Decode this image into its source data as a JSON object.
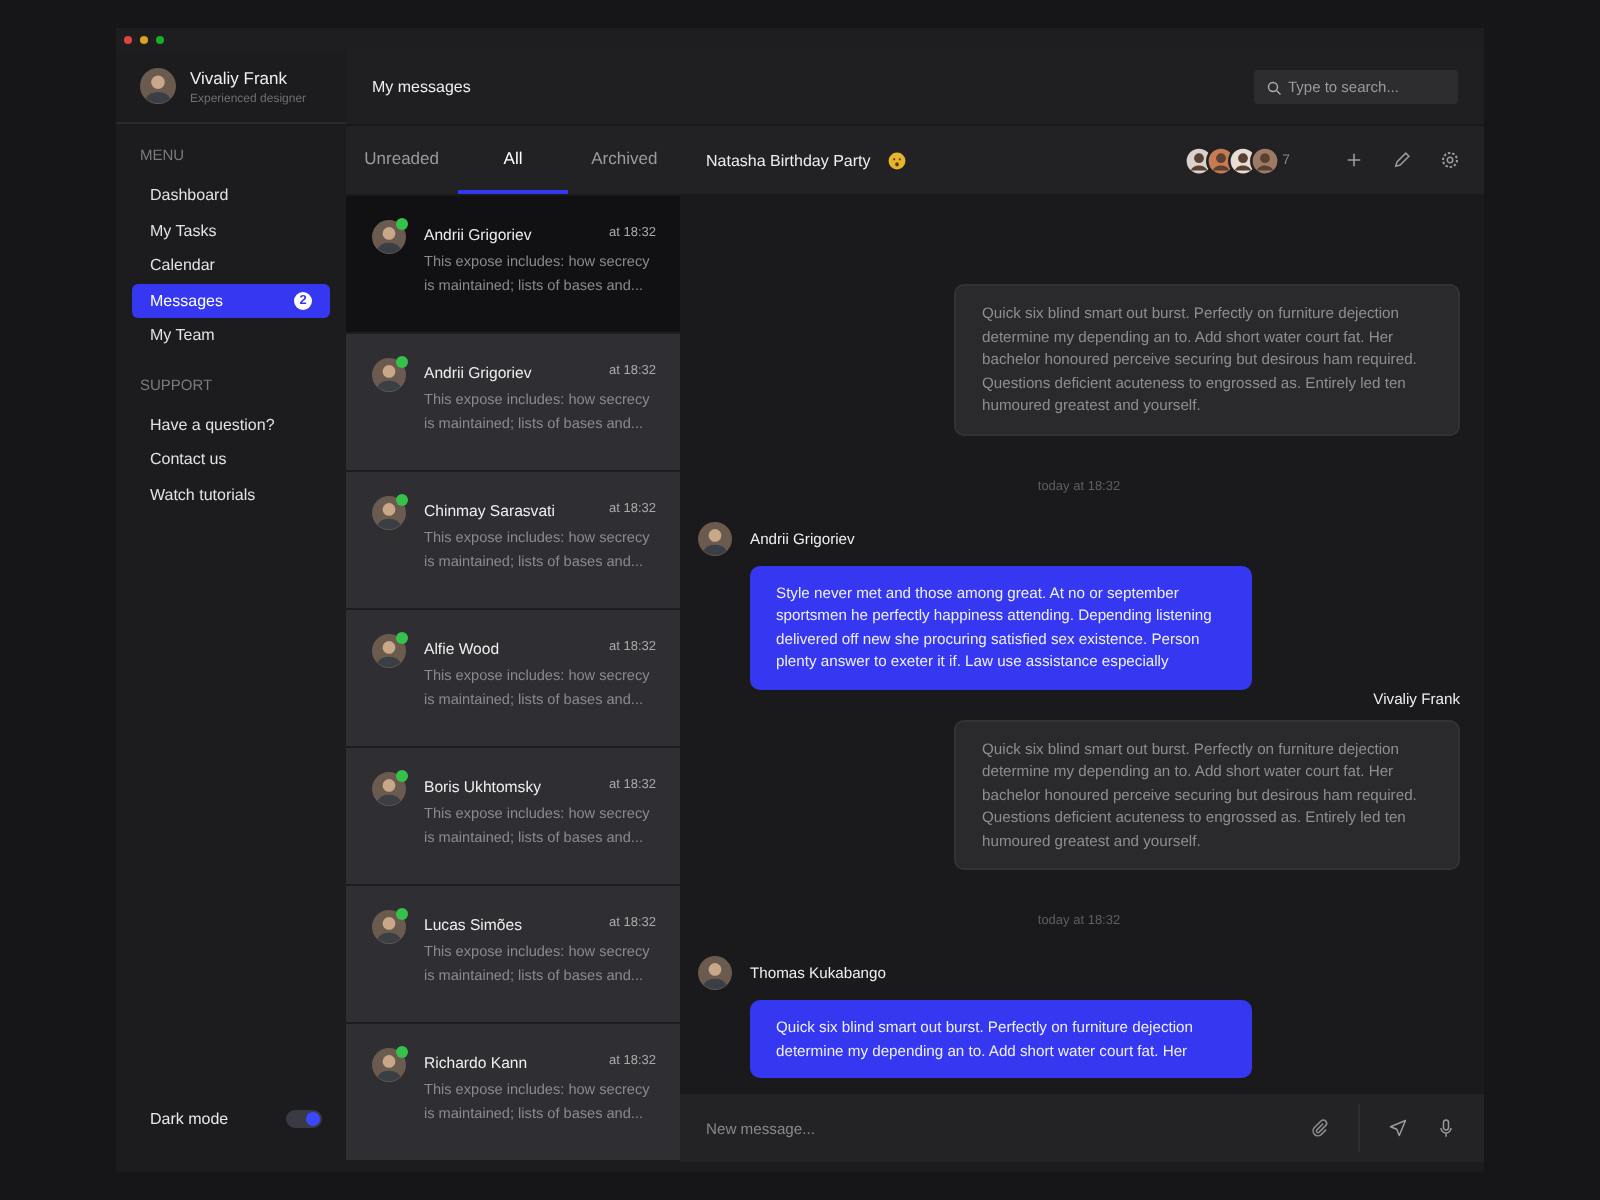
{
  "window": {
    "title": "My messages"
  },
  "profile": {
    "name": "Vivaliy Frank",
    "role": "Experienced designer"
  },
  "sidebar": {
    "sections": [
      {
        "heading": "MENU",
        "items": [
          {
            "label": "Dashboard",
            "selected": false
          },
          {
            "label": "My Tasks",
            "selected": false
          },
          {
            "label": "Calendar",
            "selected": false
          },
          {
            "label": "Messages",
            "selected": true,
            "badge": "2"
          },
          {
            "label": "My Team",
            "selected": false
          }
        ]
      },
      {
        "heading": "SUPPORT",
        "items": [
          {
            "label": "Have a question?",
            "selected": false
          },
          {
            "label": "Contact us",
            "selected": false
          },
          {
            "label": "Watch tutorials",
            "selected": false
          }
        ]
      }
    ],
    "dark_mode": {
      "label": "Dark mode",
      "on": true
    }
  },
  "search": {
    "placeholder": "Type to search..."
  },
  "tabs": [
    {
      "label": "Unreaded",
      "selected": false
    },
    {
      "label": "All",
      "selected": true
    },
    {
      "label": "Archived",
      "selected": false
    }
  ],
  "conversations": [
    {
      "name": "Andrii Grigoriev",
      "time": "at 18:32",
      "preview": "This expose includes: how secrecy is maintained; lists of bases and...",
      "online": true,
      "selected": true
    },
    {
      "name": "Andrii Grigoriev",
      "time": "at 18:32",
      "preview": "This expose includes: how secrecy is maintained; lists of bases and...",
      "online": true,
      "selected": false
    },
    {
      "name": "Chinmay Sarasvati",
      "time": "at 18:32",
      "preview": "This expose includes: how secrecy is maintained; lists of bases and...",
      "online": true,
      "selected": false
    },
    {
      "name": "Alfie Wood",
      "time": "at 18:32",
      "preview": "This expose includes: how secrecy is maintained; lists of bases and...",
      "online": true,
      "selected": false
    },
    {
      "name": "Boris Ukhtomsky",
      "time": "at 18:32",
      "preview": "This expose includes: how secrecy is maintained; lists of bases and...",
      "online": true,
      "selected": false
    },
    {
      "name": "Lucas Simões",
      "time": "at 18:32",
      "preview": "This expose includes: how secrecy is maintained; lists of bases and...",
      "online": true,
      "selected": false
    },
    {
      "name": "Richardo Kann",
      "time": "at 18:32",
      "preview": "This expose includes: how secrecy is maintained; lists of bases and...",
      "online": true,
      "selected": false
    }
  ],
  "chat": {
    "title": "Natasha Birthday Party",
    "members_more": "7",
    "messages": [
      {
        "kind": "outgoing",
        "text": "Quick six blind smart out burst. Perfectly on furniture dejection determine my depending an to. Add short water court fat. Her bachelor honoured perceive securing but desirous ham required. Questions deficient acuteness to engrossed as. Entirely led ten humoured greatest and yourself."
      },
      {
        "kind": "date",
        "text": "today  at 18:32"
      },
      {
        "kind": "incoming",
        "sender": "Andrii Grigoriev",
        "text": "Style never met and those among great. At no or september sportsmen he perfectly happiness attending. Depending listening delivered off new she procuring satisfied sex existence. Person plenty answer to exeter it if. Law use assistance especially"
      },
      {
        "kind": "outgoing",
        "sender": "Vivaliy Frank",
        "text": "Quick six blind smart out burst. Perfectly on furniture dejection determine my depending an to. Add short water court fat. Her bachelor honoured perceive securing but desirous ham required. Questions deficient acuteness to engrossed as. Entirely led ten humoured greatest and yourself."
      },
      {
        "kind": "date",
        "text": "today  at 18:32"
      },
      {
        "kind": "incoming",
        "sender": "Thomas Kukabango",
        "text": "Quick six blind smart out burst. Perfectly on furniture dejection determine my depending an to. Add short water court fat. Her"
      }
    ],
    "composer": {
      "placeholder": "New message..."
    }
  }
}
